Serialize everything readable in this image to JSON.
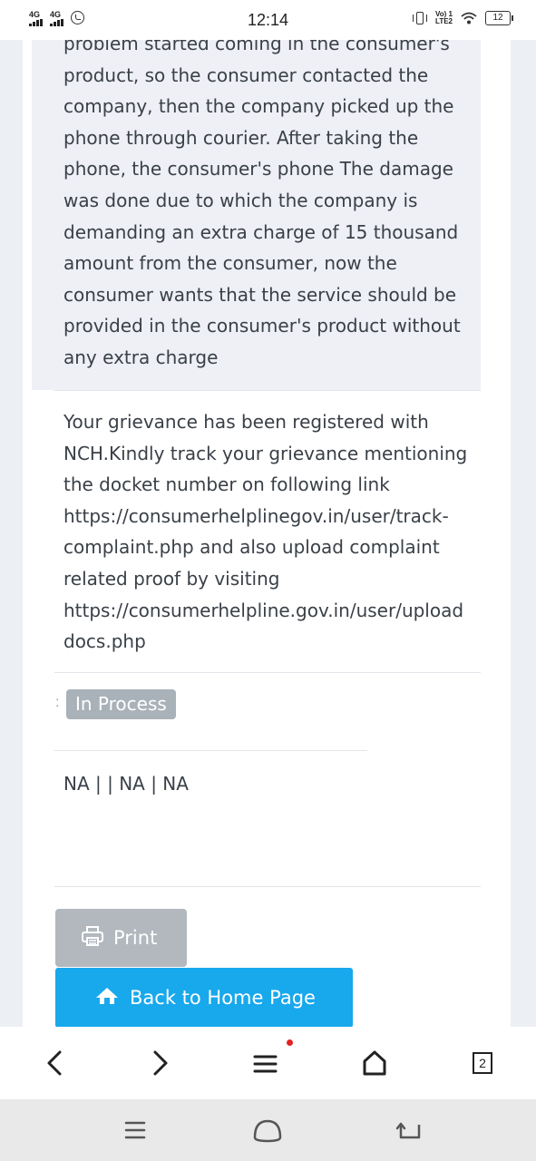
{
  "status_bar": {
    "time": "12:14",
    "network1": "4G",
    "network2": "4G",
    "volte_line1": "Vo) 1",
    "volte_line2": "LTE2",
    "battery": "12"
  },
  "complaint": {
    "text": "problem started coming in the consumer's\nproduct, so the consumer contacted the\ncompany, then the company picked up the\nphone through courier. After taking the\nphone, the consumer's phone The damage\nwas done due to which the company is\ndemanding an extra charge of 15 thousand\namount from the consumer, now the\nconsumer wants that the service should be\nprovided in the consumer's product without\nany extra charge"
  },
  "grievance_note": {
    "text": "Your grievance has been registered with\nNCH.Kindly track your grievance mentioning\nthe docket number on following link\nhttps://consumerhelplinegov.in/user/track-\ncomplaint.php and also upload complaint\nrelated proof by visiting\nhttps://consumerhelpline.gov.in/user/upload\ndocs.php"
  },
  "status": {
    "colon": ":",
    "label": "In Process"
  },
  "remarks": {
    "text": "NA | | NA | NA"
  },
  "actions": {
    "print_label": "Print",
    "home_label": "Back to Home Page"
  },
  "browser_toolbar": {
    "tab_count": "2"
  },
  "colors": {
    "badge": "#a9b1b9",
    "print_button": "#b2b8be",
    "home_button": "#18a8ec",
    "complaint_bg": "#eef0f6",
    "notification_dot": "#e32222"
  }
}
